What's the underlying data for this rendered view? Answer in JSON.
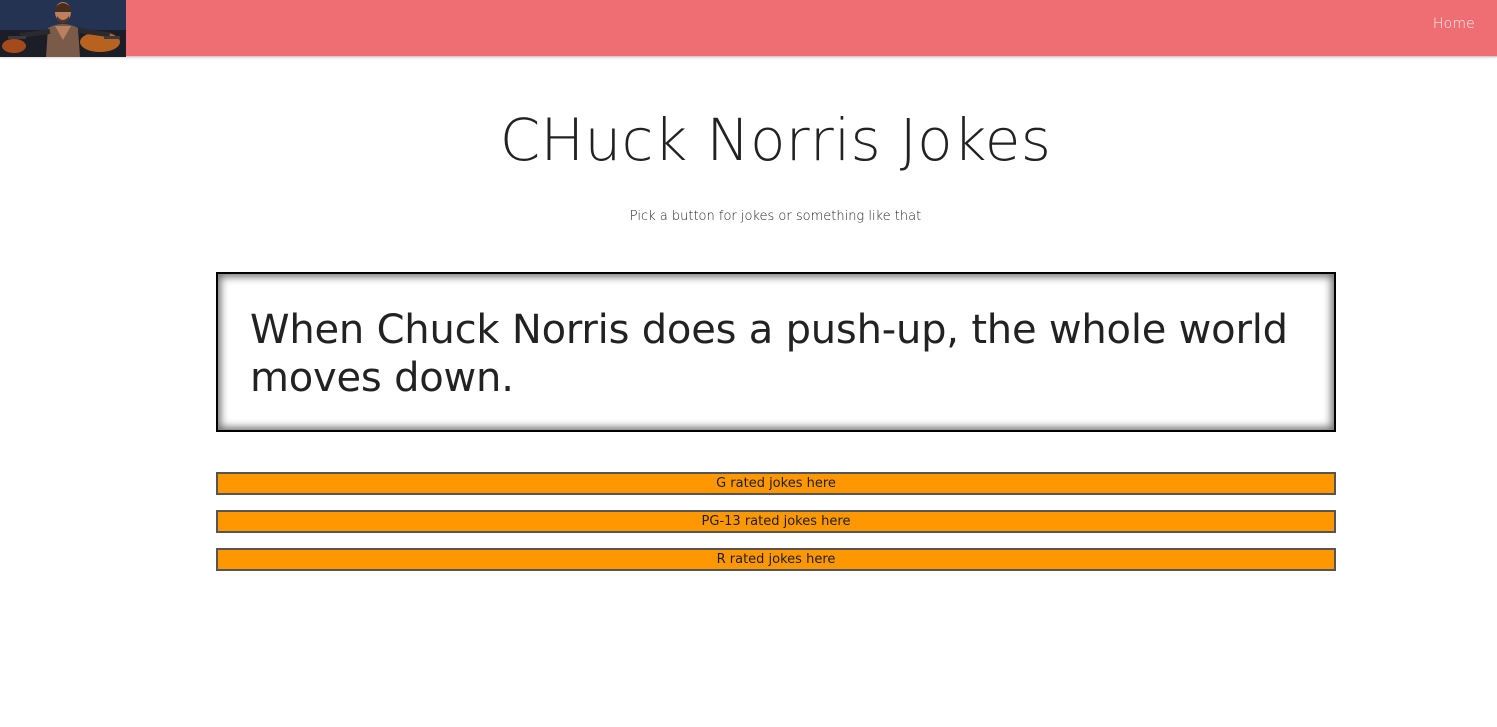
{
  "nav": {
    "logo_alt": "Chuck Norris",
    "home_label": "Home"
  },
  "header": {
    "title": "CHuck Norris Jokes",
    "subtitle": "Pick a button for jokes or something like that"
  },
  "joke": {
    "text": "When Chuck Norris does a push-up, the whole world moves down."
  },
  "buttons": {
    "g_label": "G rated jokes here",
    "pg13_label": "PG-13 rated jokes here",
    "r_label": "R rated jokes here"
  },
  "colors": {
    "navbar": "#ef6e73",
    "button": "#ff9800",
    "text": "#222222"
  }
}
